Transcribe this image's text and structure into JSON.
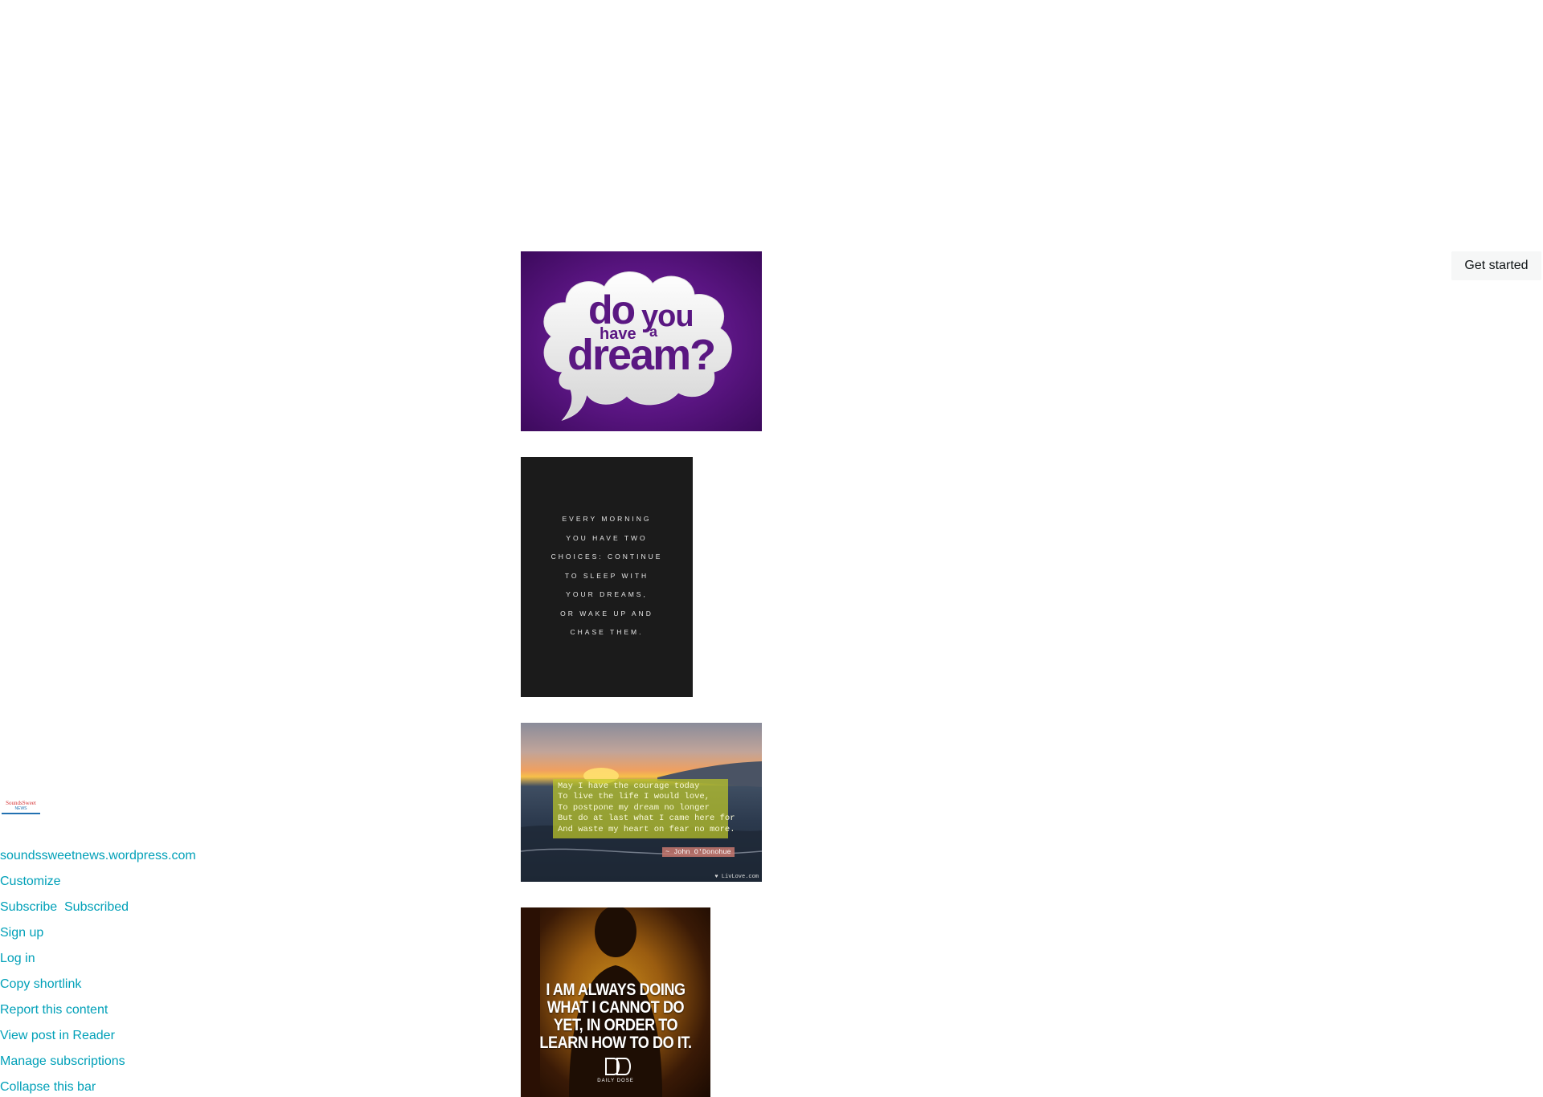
{
  "header": {
    "get_started_label": "Get started"
  },
  "post": {
    "image1": {
      "word_do": "do",
      "word_you": "you",
      "word_have": "have",
      "word_a": "a",
      "word_dream": "dream?"
    },
    "image2": {
      "lines": [
        "EVERY MORNING",
        "YOU HAVE TWO",
        "CHOICES: CONTINUE",
        "TO SLEEP WITH",
        "YOUR DREAMS,",
        "OR WAKE UP AND",
        "CHASE THEM."
      ]
    },
    "image3": {
      "quote": "May I have the courage today\nTo live the life I would love,\nTo postpone my dream no longer\nBut do at last what I came here for\nAnd waste my heart on fear no more.",
      "author": "~ John O'Donohue",
      "credit": "♥ LivLove.com"
    },
    "image4": {
      "quote": "I AM ALWAYS DOING WHAT I CANNOT DO YET, IN ORDER TO LEARN HOW TO DO IT.",
      "logo_text": "DAILY DOSE"
    }
  },
  "admin_bar": {
    "site_url": "soundssweetnews.wordpress.com",
    "customize": "Customize",
    "subscribe": "Subscribe",
    "subscribed": "Subscribed",
    "sign_up": "Sign up",
    "log_in": "Log in",
    "copy_shortlink": "Copy shortlink",
    "report_content": "Report this content",
    "view_in_reader": "View post in Reader",
    "manage_subscriptions": "Manage subscriptions",
    "collapse_bar": "Collapse this bar"
  },
  "colors": {
    "link": "#00a0b8",
    "button_bg": "#f6f7f7"
  }
}
